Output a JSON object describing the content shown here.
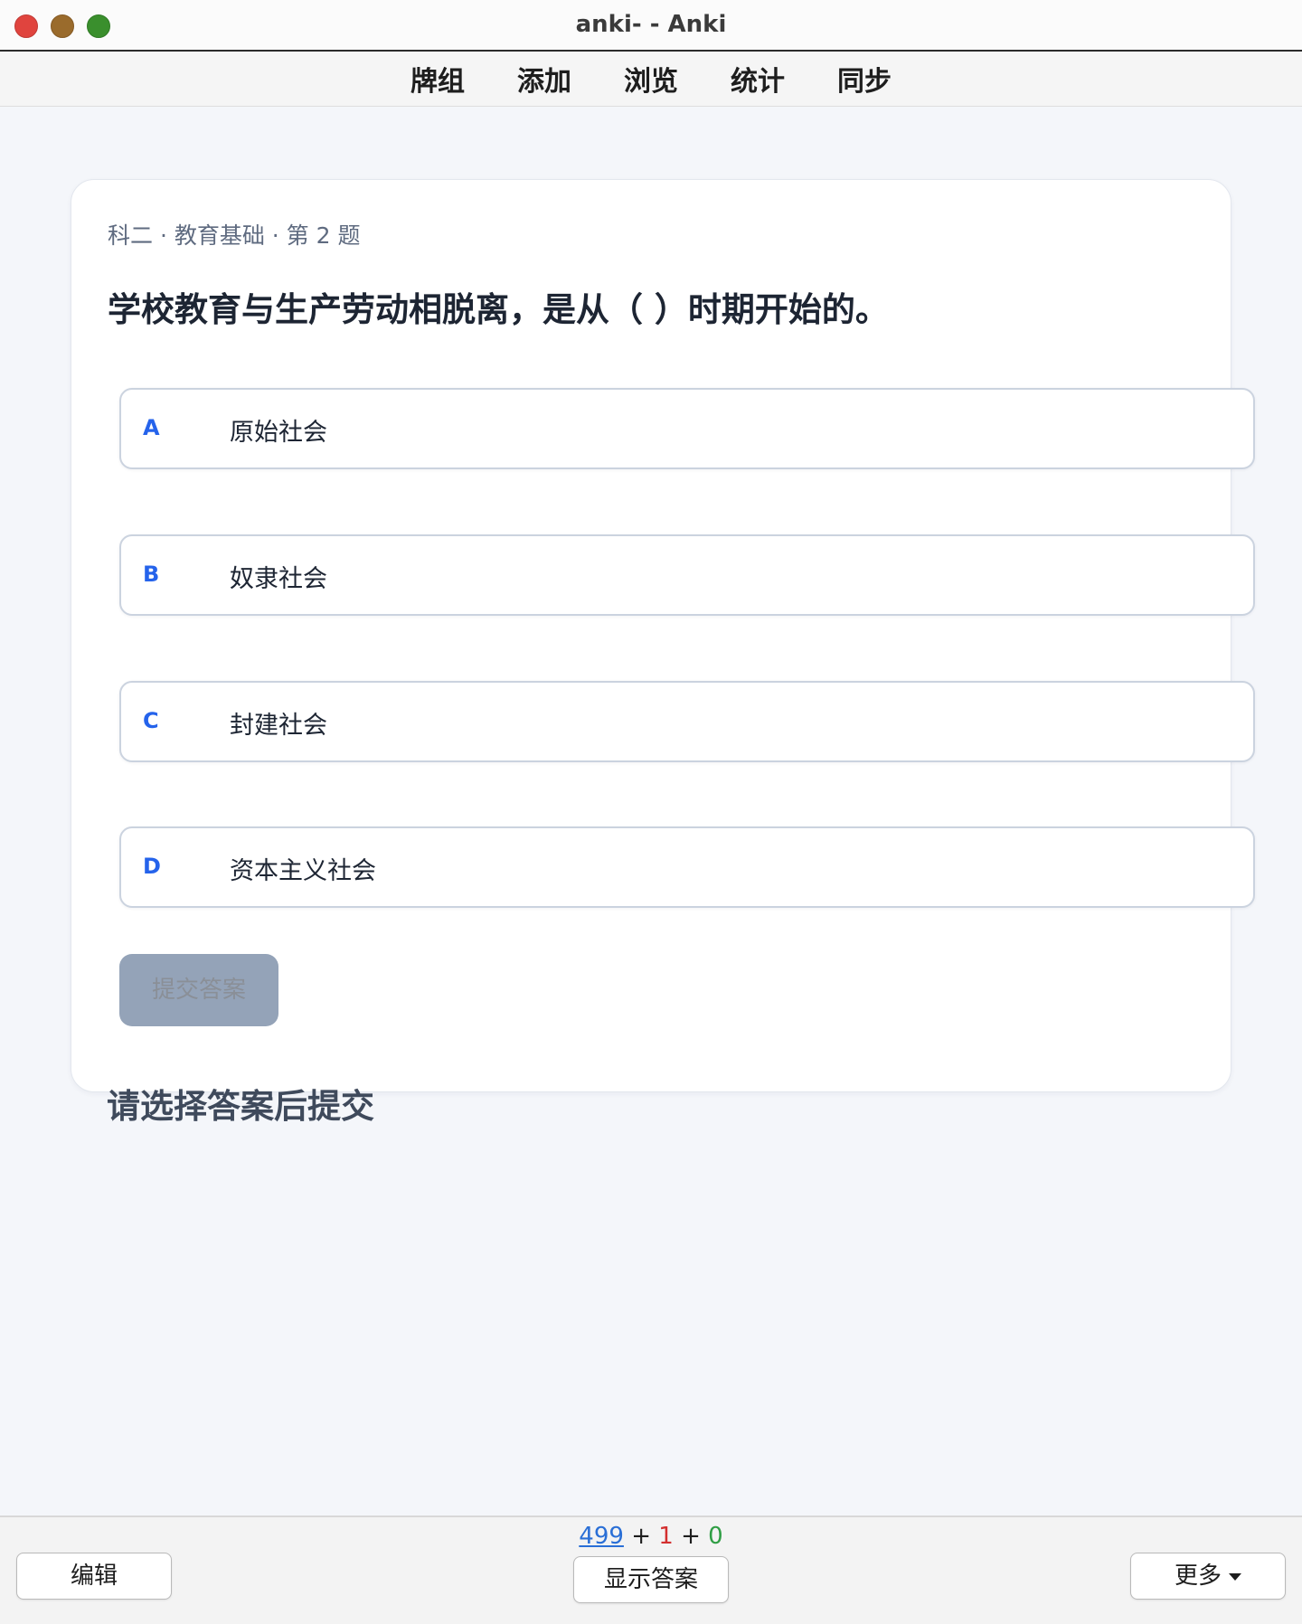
{
  "window": {
    "title": "anki- - Anki"
  },
  "toolbar": {
    "items": [
      "牌组",
      "添加",
      "浏览",
      "统计",
      "同步"
    ]
  },
  "card": {
    "meta": "科二 · 教育基础 · 第 2 题",
    "question": "学校教育与生产劳动相脱离，是从（ ）时期开始的。",
    "options": [
      {
        "letter": "A",
        "text": "原始社会"
      },
      {
        "letter": "B",
        "text": "奴隶社会"
      },
      {
        "letter": "C",
        "text": "封建社会"
      },
      {
        "letter": "D",
        "text": "资本主义社会"
      }
    ],
    "submit_label": "提交答案",
    "hint": "请选择答案后提交"
  },
  "bottom": {
    "counts": {
      "new": "499",
      "sep1": "+",
      "learn": "1",
      "sep2": "+",
      "review": "0"
    },
    "edit_label": "编辑",
    "show_answer_label": "显示答案",
    "more_label": "更多"
  },
  "colors": {
    "accent": "#2563eb",
    "new_count": "#2a6fd6",
    "learn_count": "#d32f2f",
    "review_count": "#2f9e44",
    "submit_disabled": "#94a3b8"
  }
}
